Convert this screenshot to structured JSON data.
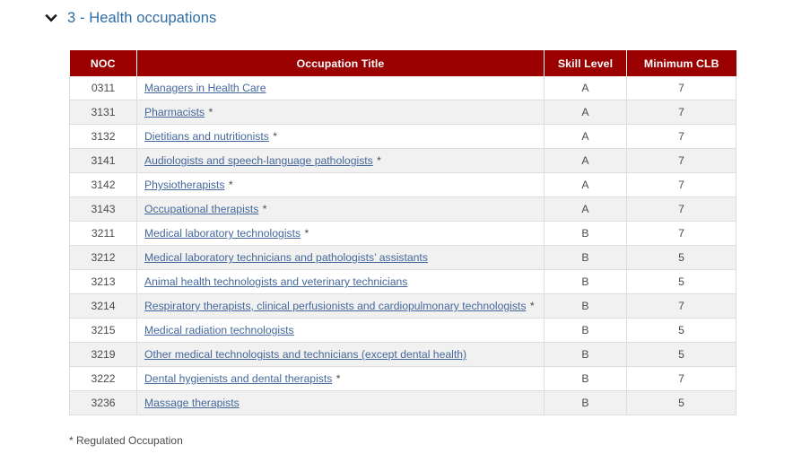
{
  "section": {
    "toggle_icon": "chevron-down-icon",
    "title": "3 - Health occupations",
    "title_color": "#2e6da4"
  },
  "table": {
    "header_bg": "#9b0000",
    "header_text_color": "#ffffff",
    "link_color": "#44689b",
    "stripe_color": "#f1f1f1",
    "columns": [
      {
        "key": "noc",
        "label": "NOC"
      },
      {
        "key": "title",
        "label": "Occupation Title"
      },
      {
        "key": "skill",
        "label": "Skill Level"
      },
      {
        "key": "clb",
        "label": "Minimum CLB"
      }
    ],
    "rows": [
      {
        "noc": "0311",
        "title": "Managers in Health Care",
        "regulated": false,
        "skill": "A",
        "clb": "7"
      },
      {
        "noc": "3131",
        "title": "Pharmacists",
        "regulated": true,
        "skill": "A",
        "clb": "7"
      },
      {
        "noc": "3132",
        "title": "Dietitians and nutritionists",
        "regulated": true,
        "skill": "A",
        "clb": "7"
      },
      {
        "noc": "3141",
        "title": "Audiologists and speech-language pathologists",
        "regulated": true,
        "skill": "A",
        "clb": "7"
      },
      {
        "noc": "3142",
        "title": "Physiotherapists",
        "regulated": true,
        "skill": "A",
        "clb": "7"
      },
      {
        "noc": "3143",
        "title": "Occupational therapists",
        "regulated": true,
        "skill": "A",
        "clb": "7"
      },
      {
        "noc": "3211",
        "title": "Medical laboratory technologists",
        "regulated": true,
        "skill": "B",
        "clb": "7"
      },
      {
        "noc": "3212",
        "title": "Medical laboratory technicians and pathologists’ assistants",
        "regulated": false,
        "skill": "B",
        "clb": "5"
      },
      {
        "noc": "3213",
        "title": "Animal health technologists and veterinary technicians",
        "regulated": false,
        "skill": "B",
        "clb": "5"
      },
      {
        "noc": "3214",
        "title": "Respiratory therapists, clinical perfusionists and cardiopulmonary technologists",
        "regulated": true,
        "skill": "B",
        "clb": "7"
      },
      {
        "noc": "3215",
        "title": "Medical radiation technologists",
        "regulated": false,
        "skill": "B",
        "clb": "5"
      },
      {
        "noc": "3219",
        "title": "Other medical technologists and technicians (except dental health)",
        "regulated": false,
        "skill": "B",
        "clb": "5"
      },
      {
        "noc": "3222",
        "title": "Dental hygienists and dental therapists",
        "regulated": true,
        "skill": "B",
        "clb": "7"
      },
      {
        "noc": "3236",
        "title": "Massage therapists",
        "regulated": false,
        "skill": "B",
        "clb": "5"
      }
    ]
  },
  "footnote": {
    "text": "* Regulated Occupation"
  },
  "misc": {
    "star": "*"
  }
}
